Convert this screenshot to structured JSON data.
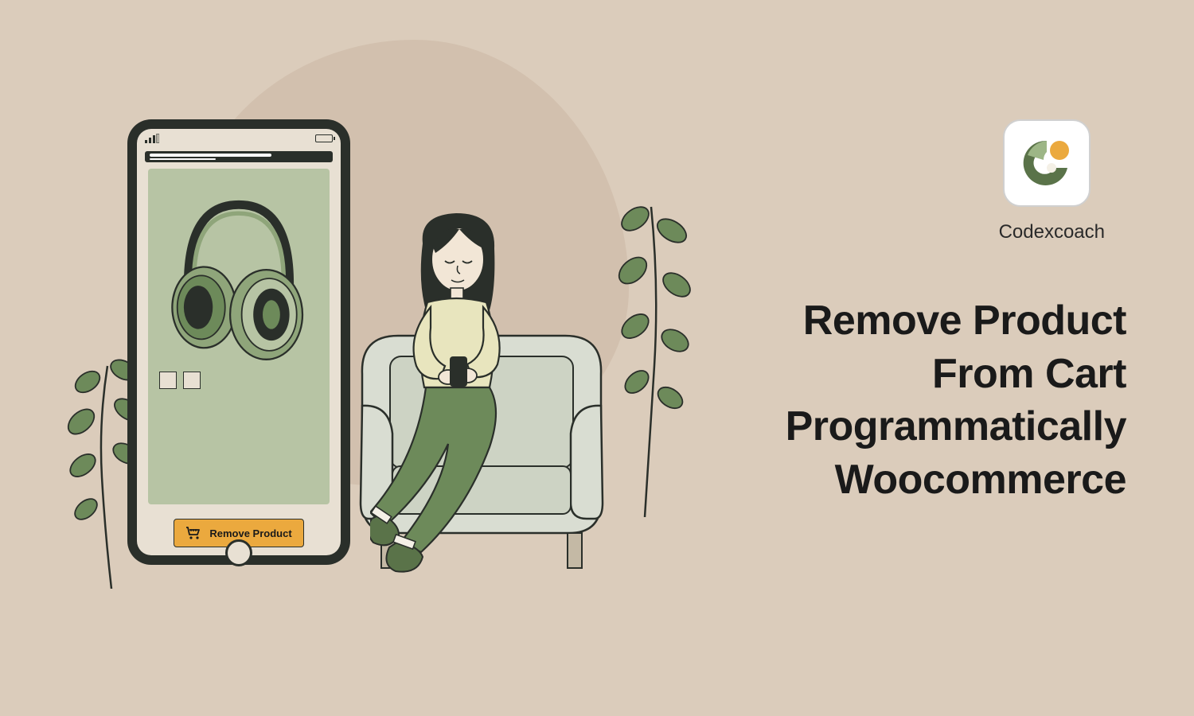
{
  "brand": {
    "name": "Codexcoach"
  },
  "title": {
    "line1": "Remove Product",
    "line2": "From Cart",
    "line3": "Programmatically",
    "line4": "Woocommerce"
  },
  "phone": {
    "remove_button_label": "Remove Product"
  },
  "colors": {
    "bg": "#dbccbb",
    "accent_orange": "#eba93e",
    "accent_green": "#6d8a5a",
    "dark": "#2a2f2a"
  }
}
